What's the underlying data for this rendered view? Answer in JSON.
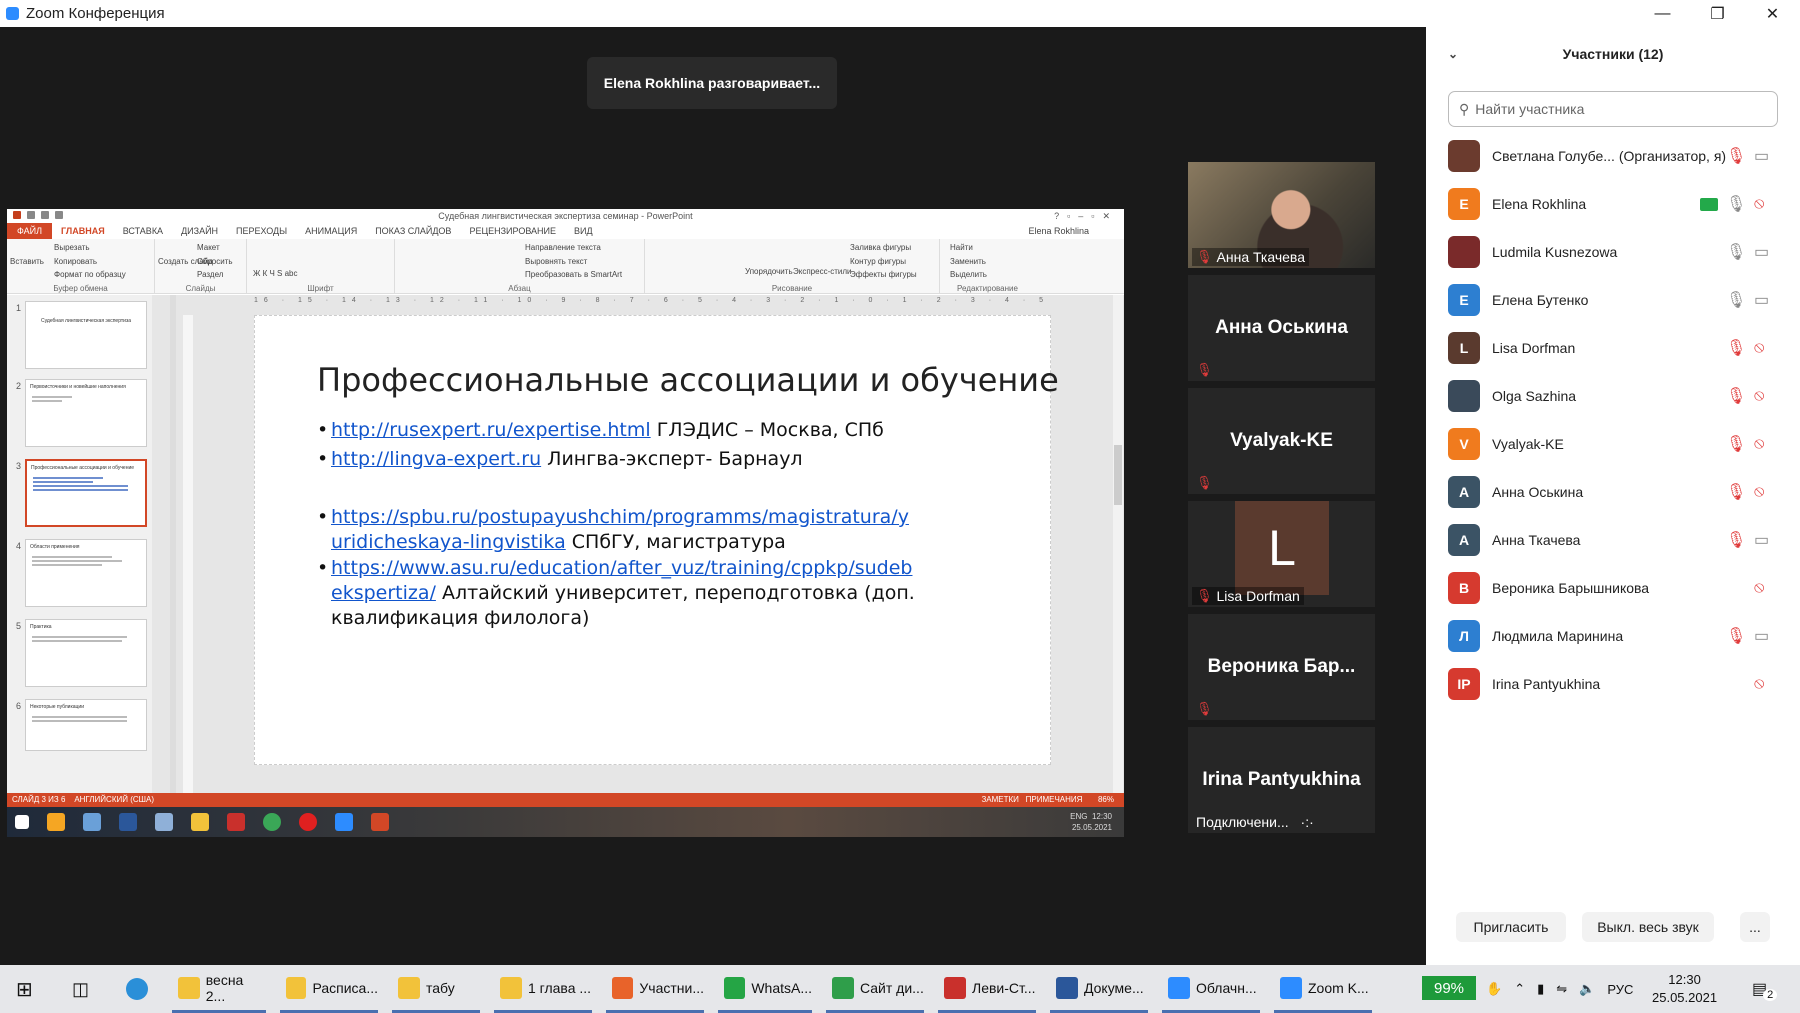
{
  "app": {
    "title": "Zoom Конференция"
  },
  "speaking": "Elena Rokhlina разговаривает...",
  "ppt": {
    "window_title": "Судебная лингвистическая экспертиза семинар - PowerPoint",
    "tabs": [
      "ФАЙЛ",
      "ГЛАВНАЯ",
      "ВСТАВКА",
      "ДИЗАЙН",
      "ПЕРЕХОДЫ",
      "АНИМАЦИЯ",
      "ПОКАЗ СЛАЙДОВ",
      "РЕЦЕНЗИРОВАНИЕ",
      "ВИД"
    ],
    "user": "Elena Rokhlina",
    "ribbon": {
      "paste": "Вставить",
      "cut": "Вырезать",
      "copy": "Копировать",
      "format": "Формат по образцу",
      "clipboard": "Буфер обмена",
      "new_slide": "Создать слайд",
      "layout": "Макет",
      "reset": "Сбросить",
      "section": "Раздел",
      "slides": "Слайды",
      "font": "Шрифт",
      "text_dir": "Направление текста",
      "align_text": "Выровнять текст",
      "smartart": "Преобразовать в SmartArt",
      "paragraph": "Абзац",
      "arrange": "Упорядочить",
      "quick_styles": "Экспресс-стили",
      "fill": "Заливка фигуры",
      "outline": "Контур фигуры",
      "effects": "Эффекты фигуры",
      "drawing": "Рисование",
      "find": "Найти",
      "replace": "Заменить",
      "select": "Выделить",
      "editing": "Редактирование"
    },
    "ruler": "16 · 15 · 14 · 13 · 12 · 11 · 10 · 9 · 8 · 7 · 6 · 5 · 4 · 3 · 2 · 1 · 0 · 1 · 2 · 3 · 4 · 5 · 6 · 7 · 8 · 9 · 10 · 11 · 12 · 13 · 14 · 15 · 16",
    "thumbs": [
      {
        "num": "1",
        "title": "Судебная лингвистическая экспертиза"
      },
      {
        "num": "2",
        "title": "Первоисточники и новейшие наполнения"
      },
      {
        "num": "3",
        "title": "Профессиональные ассоциации и обучение"
      },
      {
        "num": "4",
        "title": "Области применения"
      },
      {
        "num": "5",
        "title": "Практика"
      },
      {
        "num": "6",
        "title": "Некоторые публикации"
      }
    ],
    "slide": {
      "title": "Профессиональные ассоциации и обучение",
      "b1_link": "http://rusexpert.ru/expertise.html",
      "b1_text": " ГЛЭДИС – Москва, СПб",
      "b2_link": "http://lingva-expert.ru",
      "b2_text": " Лингва-эксперт- Барнаул",
      "b3_link": "https://spbu.ru/postupayushchim/programms/magistratura/yuridicheskaya-lingvistika",
      "b3_text": " СПбГУ, магистратура",
      "b4_link": "https://www.asu.ru/education/after_vuz/training/cppkp/sudebekspertiza/",
      "b4_text": " Алтайский университет, переподготовка (доп. квалификация филолога)",
      "bullet": "•"
    },
    "status": {
      "slide": "СЛАЙД 3 ИЗ 6",
      "lang": "АНГЛИЙСКИЙ (США)",
      "notes": "ЗАМЕТКИ",
      "comments": "ПРИМЕЧАНИЯ",
      "zoom": "86%"
    },
    "task_clock": {
      "time": "12:30",
      "date": "25.05.2021",
      "lang": "ENG"
    }
  },
  "tiles": [
    {
      "name": "Анна Ткачева",
      "type": "video"
    },
    {
      "name": "Анна Оськина",
      "type": "name"
    },
    {
      "name": "Vyalyak-KE",
      "type": "name"
    },
    {
      "name": "Lisa Dorfman",
      "type": "letter",
      "letter": "L"
    },
    {
      "name": "Вероника Бар...",
      "type": "name"
    },
    {
      "name": "Irina Pantyukhina",
      "type": "name",
      "status": "Подключени..."
    }
  ],
  "participants": {
    "title": "Участники (12)",
    "search_placeholder": "Найти участника",
    "list": [
      {
        "name": "Светлана Голубе... (Организатор, я)",
        "avatar": "",
        "color": "#6b3b2e",
        "mic": "muted",
        "cam": "on"
      },
      {
        "name": "Elena Rokhlina",
        "avatar": "E",
        "color": "#f07b1e",
        "mic": "on",
        "cam": "off",
        "sharing": true
      },
      {
        "name": "Ludmila Kusnezowa",
        "avatar": "",
        "color": "#7a2a2a",
        "mic": "on",
        "cam": "on"
      },
      {
        "name": "Елена Бутенко",
        "avatar": "E",
        "color": "#2d7fd1",
        "mic": "on",
        "cam": "on"
      },
      {
        "name": "Lisa Dorfman",
        "avatar": "L",
        "color": "#5a3a2e",
        "mic": "muted",
        "cam": "off"
      },
      {
        "name": "Olga Sazhina",
        "avatar": "",
        "color": "#3a4a5a",
        "mic": "muted",
        "cam": "off"
      },
      {
        "name": "Vyalyak-KE",
        "avatar": "V",
        "color": "#f07b1e",
        "mic": "muted",
        "cam": "off"
      },
      {
        "name": "Анна Оськина",
        "avatar": "A",
        "color": "#3b5365",
        "mic": "muted",
        "cam": "off"
      },
      {
        "name": "Анна Ткачева",
        "avatar": "A",
        "color": "#3b5365",
        "mic": "muted",
        "cam": "on"
      },
      {
        "name": "Вероника Барышникова",
        "avatar": "B",
        "color": "#d63a2f",
        "mic": "",
        "cam": "off"
      },
      {
        "name": "Людмила Маринина",
        "avatar": "Л",
        "color": "#2d7fd1",
        "mic": "muted",
        "cam": "on"
      },
      {
        "name": "Irina Pantyukhina",
        "avatar": "IP",
        "color": "#d63a2f",
        "mic": "",
        "cam": "off"
      }
    ],
    "invite": "Пригласить",
    "mute_all": "Выкл. весь звук",
    "more": "..."
  },
  "taskbar": {
    "items": [
      {
        "label": "весна 2...",
        "color": "#f2c23a"
      },
      {
        "label": "Расписа...",
        "color": "#f2c23a"
      },
      {
        "label": "табу",
        "color": "#f2c23a"
      },
      {
        "label": "1 глава ...",
        "color": "#f2c23a"
      },
      {
        "label": "Участни...",
        "color": "#e8632a"
      },
      {
        "label": "WhatsA...",
        "color": "#25a545"
      },
      {
        "label": "Сайт ди...",
        "color": "#2f9e4a"
      },
      {
        "label": "Леви-Ст...",
        "color": "#c9302c"
      },
      {
        "label": "Докуме...",
        "color": "#2b579a"
      },
      {
        "label": "Облачн...",
        "color": "#2d8cff"
      },
      {
        "label": "Zoom K...",
        "color": "#2d8cff"
      }
    ],
    "battery": "99%",
    "lang": "РУС",
    "time": "12:30",
    "date": "25.05.2021",
    "notif": "2"
  }
}
